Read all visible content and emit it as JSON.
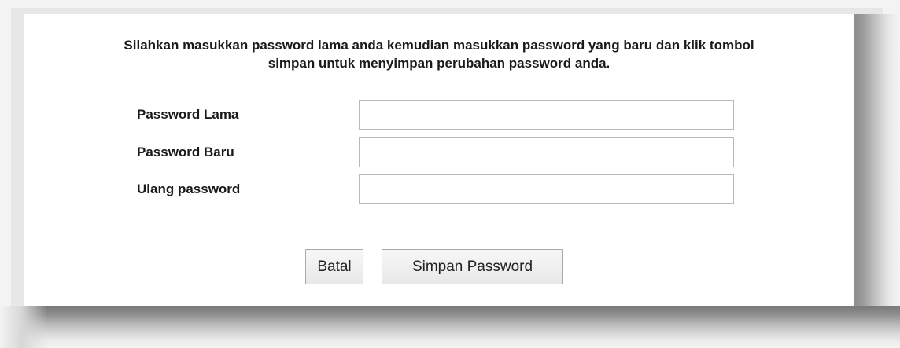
{
  "dialog": {
    "instruction_line1": "Silahkan masukkan password lama anda kemudian masukkan password yang baru dan klik tombol",
    "instruction_line2": "simpan untuk menyimpan perubahan password anda."
  },
  "form": {
    "fields": [
      {
        "label": "Password Lama",
        "value": "",
        "placeholder": ""
      },
      {
        "label": "Password Baru",
        "value": "",
        "placeholder": ""
      },
      {
        "label": "Ulang password",
        "value": "",
        "placeholder": ""
      }
    ]
  },
  "actions": {
    "cancel_label": "Batal",
    "save_label": "Simpan Password"
  },
  "colors": {
    "panel_background": "#ffffff",
    "text": "#1a1a1a",
    "input_border": "#b9b9b9",
    "button_border": "#a9a9a9"
  }
}
